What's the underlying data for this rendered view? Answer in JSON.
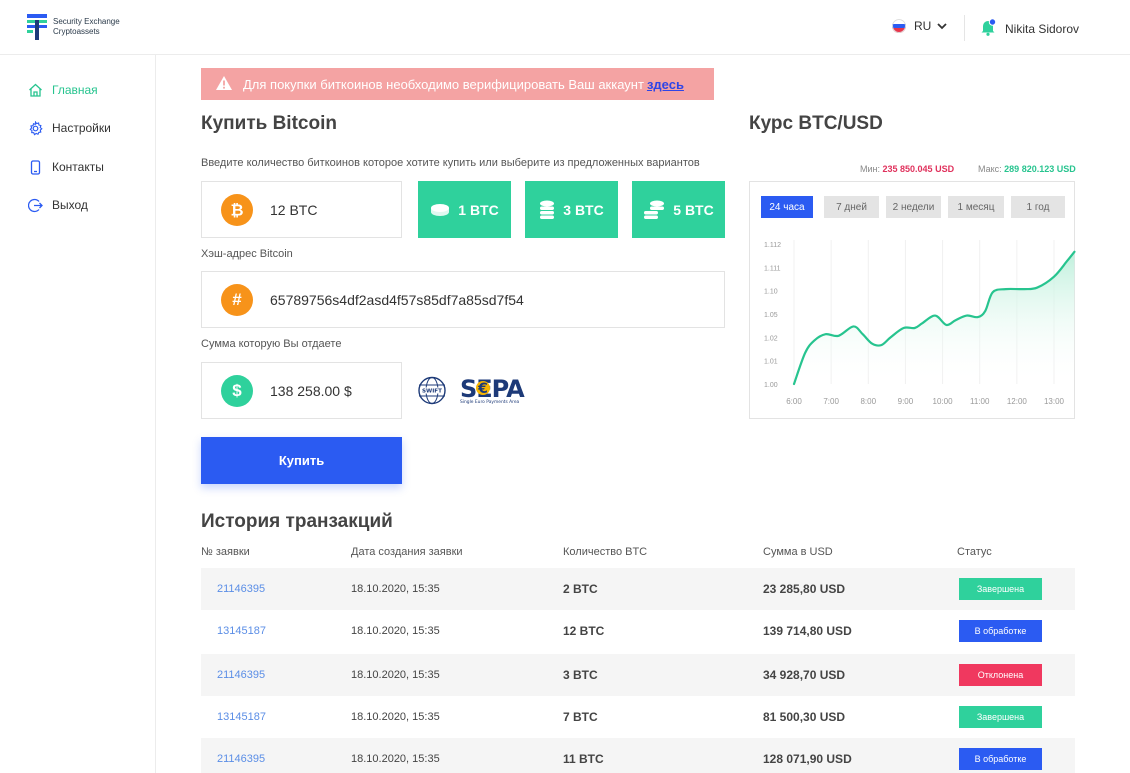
{
  "app": {
    "logo_line1": "Security Exchange",
    "logo_line2": "Cryptoassets"
  },
  "header": {
    "language": "RU",
    "user_name": "Nikita Sidorov"
  },
  "sidebar": {
    "items": [
      {
        "label": "Главная",
        "icon": "home-icon",
        "active": true
      },
      {
        "label": "Настройки",
        "icon": "gear-icon",
        "active": false
      },
      {
        "label": "Контакты",
        "icon": "phone-icon",
        "active": false
      },
      {
        "label": "Выход",
        "icon": "logout-icon",
        "active": false
      }
    ]
  },
  "alert": {
    "text": "Для покупки биткоинов необходимо верифицировать Ваш аккаунт",
    "link": "здесь"
  },
  "buy": {
    "title": "Купить Bitcoin",
    "instruction": "Введите количество биткоинов которое хотите купить или выберите из предложенных вариантов",
    "amount_value": "12 BTC",
    "presets": [
      "1 BTC",
      "3 BTC",
      "5 BTC"
    ],
    "hash_label": "Хэш-адрес Bitcoin",
    "hash_value": "65789756s4df2asd4f57s85df7a85sd7f54",
    "pay_label": "Сумма которую Вы отдаете",
    "pay_value": "138 258.00 $",
    "swift_text": "SWIFT",
    "sepa_text": "SEPA",
    "sepa_sub1": "Single Euro Payments Area",
    "buy_button": "Купить"
  },
  "rate": {
    "title": "Курс BTC/USD",
    "min_label": "Мин:",
    "min_value": "235 850.045 USD",
    "max_label": "Макс:",
    "max_value": "289 820.123 USD",
    "tabs": [
      "24 часа",
      "7 дней",
      "2 недели",
      "1 месяц",
      "1 год"
    ],
    "active_tab": 0
  },
  "chart_data": {
    "type": "area",
    "x": [
      "6:00",
      "7:00",
      "8:00",
      "9:00",
      "10:00",
      "11:00",
      "12:00",
      "13:00"
    ],
    "yticks": [
      "1.112",
      "1.111",
      "1.10",
      "1.05",
      "1.02",
      "1.01",
      "1.00"
    ],
    "series": [
      {
        "points": [
          [
            0,
            0.0
          ],
          [
            0.3,
            0.2
          ],
          [
            0.55,
            0.28
          ],
          [
            0.85,
            0.32
          ],
          [
            1.2,
            0.31
          ],
          [
            1.6,
            0.37
          ],
          [
            1.85,
            0.32
          ],
          [
            2.1,
            0.26
          ],
          [
            2.35,
            0.25
          ],
          [
            2.6,
            0.3
          ],
          [
            2.95,
            0.36
          ],
          [
            3.25,
            0.36
          ],
          [
            3.45,
            0.39
          ],
          [
            3.8,
            0.44
          ],
          [
            4.1,
            0.38
          ],
          [
            4.35,
            0.41
          ],
          [
            4.65,
            0.44
          ],
          [
            4.95,
            0.43
          ],
          [
            5.15,
            0.47
          ],
          [
            5.35,
            0.59
          ],
          [
            5.7,
            0.61
          ],
          [
            6.2,
            0.61
          ],
          [
            6.55,
            0.62
          ],
          [
            7.0,
            0.69
          ],
          [
            7.35,
            0.79
          ],
          [
            7.55,
            0.85
          ]
        ]
      }
    ],
    "colors": {
      "line": "#27c48f",
      "fill": "#e3f8ef"
    },
    "grid": true,
    "legend": false
  },
  "history": {
    "title": "История транзакций",
    "headers": [
      "№ заявки",
      "Дата создания заявки",
      "Количество BTC",
      "Сумма в USD",
      "Статус"
    ],
    "rows": [
      {
        "id": "21146395",
        "date": "18.10.2020, 15:35",
        "btc": "2 BTC",
        "usd": "23 285,80 USD",
        "status": "Завершена",
        "color": "#2fd19c"
      },
      {
        "id": "13145187",
        "date": "18.10.2020, 15:35",
        "btc": "12 BTC",
        "usd": "139 714,80 USD",
        "status": "В обработке",
        "color": "#2b5bf2"
      },
      {
        "id": "21146395",
        "date": "18.10.2020, 15:35",
        "btc": "3 BTC",
        "usd": "34 928,70 USD",
        "status": "Отклонена",
        "color": "#f0385f"
      },
      {
        "id": "13145187",
        "date": "18.10.2020, 15:35",
        "btc": "7 BTC",
        "usd": "81 500,30 USD",
        "status": "Завершена",
        "color": "#2fd19c"
      },
      {
        "id": "21146395",
        "date": "18.10.2020, 15:35",
        "btc": "11 BTC",
        "usd": "128 071,90 USD",
        "status": "В обработке",
        "color": "#2b5bf2"
      }
    ]
  }
}
